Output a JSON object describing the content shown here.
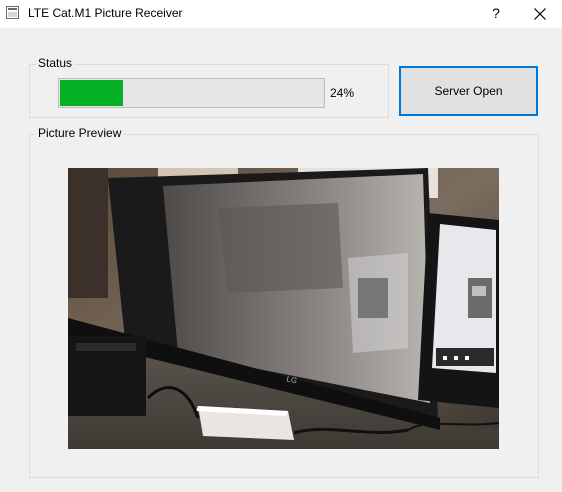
{
  "window": {
    "title": "LTE Cat.M1 Picture Receiver",
    "help_label": "?",
    "icons": {
      "app": "app-window-icon",
      "close": "close-icon"
    }
  },
  "status": {
    "group_title": "Status",
    "progress_value": 0.24,
    "progress_text": "24%",
    "progress_color": "#06b025"
  },
  "server_button": {
    "label": "Server Open",
    "focus_color": "#0078d7"
  },
  "preview": {
    "group_title": "Picture Preview",
    "image_description_icon": "picture-preview-image"
  }
}
